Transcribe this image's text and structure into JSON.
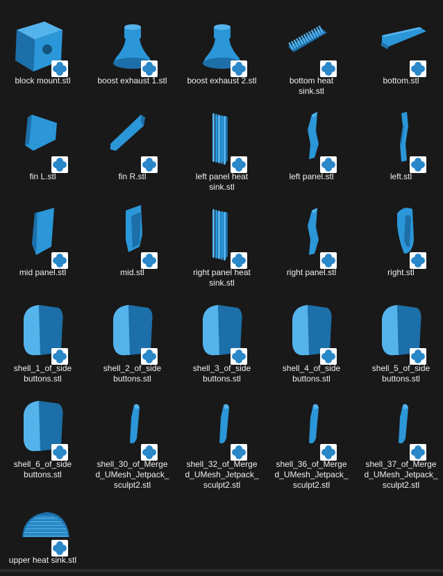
{
  "colors": {
    "background": "#191919",
    "model": "#2b96d8",
    "model_dark": "#1c6fa8",
    "model_light": "#55b3ec",
    "badge_bg": "#ffffff",
    "badge_icon": "#2a87c8",
    "label": "#f0f0f0"
  },
  "badge_icon": "3d-builder-app-icon",
  "files": [
    {
      "name": "block mount.stl",
      "label_lines": [
        "block mount.stl"
      ],
      "shape": "cube"
    },
    {
      "name": "boost exhaust 1.stl",
      "label_lines": [
        "boost exhaust 1.stl"
      ],
      "shape": "bell"
    },
    {
      "name": "boost exhaust 2.stl",
      "label_lines": [
        "boost exhaust 2.stl"
      ],
      "shape": "bell"
    },
    {
      "name": "bottom heat sink.stl",
      "label_lines": [
        "bottom heat",
        "sink.stl"
      ],
      "shape": "fins-h"
    },
    {
      "name": "bottom.stl",
      "label_lines": [
        "bottom.stl"
      ],
      "shape": "wedge"
    },
    {
      "name": "fin L.stl",
      "label_lines": [
        "fin L.stl"
      ],
      "shape": "fin-l"
    },
    {
      "name": "fin R.stl",
      "label_lines": [
        "fin R.stl"
      ],
      "shape": "fin-r"
    },
    {
      "name": "left panel heat sink.stl",
      "label_lines": [
        "left panel heat",
        "sink.stl"
      ],
      "shape": "fins-v"
    },
    {
      "name": "left panel.stl",
      "label_lines": [
        "left panel.stl"
      ],
      "shape": "panel-thin"
    },
    {
      "name": "left.stl",
      "label_lines": [
        "left.stl"
      ],
      "shape": "side-thin"
    },
    {
      "name": "mid panel.stl",
      "label_lines": [
        "mid panel.stl"
      ],
      "shape": "mid-panel"
    },
    {
      "name": "mid.stl",
      "label_lines": [
        "mid.stl"
      ],
      "shape": "mid"
    },
    {
      "name": "right panel heat sink.stl",
      "label_lines": [
        "right panel heat",
        "sink.stl"
      ],
      "shape": "fins-v"
    },
    {
      "name": "right panel.stl",
      "label_lines": [
        "right panel.stl"
      ],
      "shape": "panel-thin"
    },
    {
      "name": "right.stl",
      "label_lines": [
        "right.stl"
      ],
      "shape": "side-round"
    },
    {
      "name": "shell_1_of_side buttons.stl",
      "label_lines": [
        "shell_1_of_side",
        "buttons.stl"
      ],
      "shape": "shell"
    },
    {
      "name": "shell_2_of_side buttons.stl",
      "label_lines": [
        "shell_2_of_side",
        "buttons.stl"
      ],
      "shape": "shell"
    },
    {
      "name": "shell_3_of_side buttons.stl",
      "label_lines": [
        "shell_3_of_side",
        "buttons.stl"
      ],
      "shape": "shell"
    },
    {
      "name": "shell_4_of_side buttons.stl",
      "label_lines": [
        "shell_4_of_side",
        "buttons.stl"
      ],
      "shape": "shell"
    },
    {
      "name": "shell_5_of_side buttons.stl",
      "label_lines": [
        "shell_5_of_side",
        "buttons.stl"
      ],
      "shape": "shell"
    },
    {
      "name": "shell_6_of_side buttons.stl",
      "label_lines": [
        "shell_6_of_side",
        "buttons.stl"
      ],
      "shape": "shell"
    },
    {
      "name": "shell_30_of_Merged_UMesh_Jetpack_sculpt2.stl",
      "label_lines": [
        "shell_30_of_Merge",
        "d_UMesh_Jetpack_",
        "sculpt2.stl"
      ],
      "shape": "sliver"
    },
    {
      "name": "shell_32_of_Merged_UMesh_Jetpack_sculpt2.stl",
      "label_lines": [
        "shell_32_of_Merge",
        "d_UMesh_Jetpack_",
        "sculpt2.stl"
      ],
      "shape": "sliver"
    },
    {
      "name": "shell_36_of_Merged_UMesh_Jetpack_sculpt2.stl",
      "label_lines": [
        "shell_36_of_Merge",
        "d_UMesh_Jetpack_",
        "sculpt2.stl"
      ],
      "shape": "sliver"
    },
    {
      "name": "shell_37_of_Merged_UMesh_Jetpack_sculpt2.stl",
      "label_lines": [
        "shell_37_of_Merge",
        "d_UMesh_Jetpack_",
        "sculpt2.stl"
      ],
      "shape": "sliver"
    },
    {
      "name": "upper heat sink.stl",
      "label_lines": [
        "upper heat sink.stl"
      ],
      "shape": "dome-fins"
    }
  ]
}
